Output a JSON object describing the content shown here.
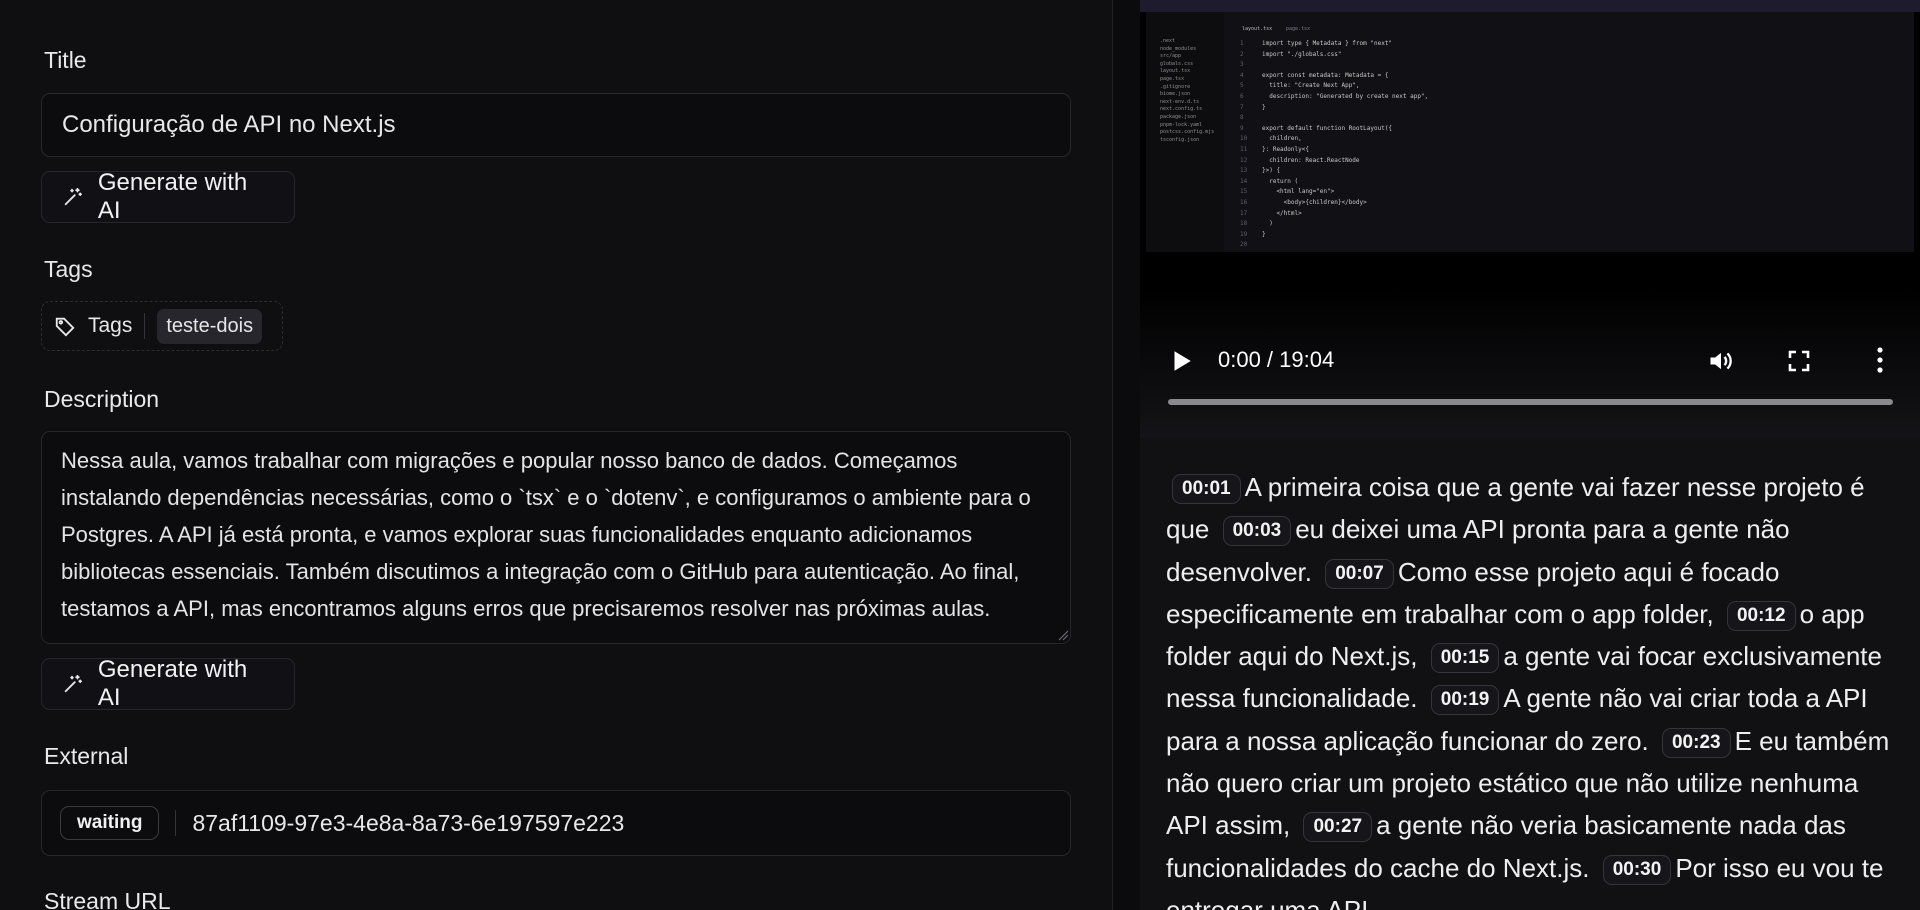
{
  "form": {
    "title_label": "Title",
    "title_value": "Configuração de API no Next.js",
    "generate_label": "Generate with AI",
    "tags_label": "Tags",
    "tags_button": "Tags",
    "tags": [
      "teste-dois"
    ],
    "description_label": "Description",
    "description_value": "Nessa aula, vamos trabalhar com migrações e popular nosso banco de dados. Começamos instalando dependências necessárias, como o `tsx` e o `dotenv`, e configuramos o ambiente para o Postgres. A API já está pronta, e vamos explorar suas funcionalidades enquanto adicionamos bibliotecas essenciais. Também discutimos a integração com o GitHub para autenticação. Ao final, testamos a API, mas encontramos alguns erros que precisaremos resolver nas próximas aulas.",
    "external_label": "External",
    "external_status": "waiting",
    "external_id": "87af1109-97e3-4e8a-8a73-6e197597e223",
    "stream_url_label": "Stream URL"
  },
  "video": {
    "time": "0:00 / 19:04",
    "progress": 0,
    "icons": [
      "play-icon",
      "volume-icon",
      "fullscreen-icon",
      "more-vertical-icon"
    ],
    "screen": {
      "tabs": [
        "layout.tsx",
        "page.tsx"
      ],
      "files": [
        ".next",
        "node_modules",
        "src/app",
        "globals.css",
        "layout.tsx",
        "page.tsx",
        ".gitignore",
        "biome.json",
        "next-env.d.ts",
        "next.config.ts",
        "package.json",
        "pnpm-lock.yaml",
        "postcss.config.mjs",
        "tsconfig.json"
      ],
      "code": [
        "import type { Metadata } from \"next\"",
        "import \"./globals.css\"",
        "",
        "export const metadata: Metadata = {",
        "  title: \"Create Next App\",",
        "  description: \"Generated by create next app\",",
        "}",
        "",
        "export default function RootLayout({",
        "  children,",
        "}: Readonly<{",
        "  children: React.ReactNode",
        "}>) {",
        "  return (",
        "    <html lang=\"en\">",
        "      <body>{children}</body>",
        "    </html>",
        "  )",
        "}",
        ""
      ]
    }
  },
  "transcript": [
    {
      "t": "00:01",
      "text": "A primeira coisa que a gente vai fazer nesse projeto é que"
    },
    {
      "t": "00:03",
      "text": "eu deixei uma API pronta para a gente não desenvolver."
    },
    {
      "t": "00:07",
      "text": "Como esse projeto aqui é focado especificamente em trabalhar com o app folder,"
    },
    {
      "t": "00:12",
      "text": "o app folder aqui do Next.js,"
    },
    {
      "t": "00:15",
      "text": "a gente vai focar exclusivamente nessa funcionalidade."
    },
    {
      "t": "00:19",
      "text": "A gente não vai criar toda a API para a nossa aplicação funcionar do zero."
    },
    {
      "t": "00:23",
      "text": "E eu também não quero criar um projeto estático que não utilize nenhuma API assim,"
    },
    {
      "t": "00:27",
      "text": "a gente não veria basicamente nada das funcionalidades do cache do Next.js."
    },
    {
      "t": "00:30",
      "text": "Por isso eu vou te entregar uma API"
    }
  ]
}
